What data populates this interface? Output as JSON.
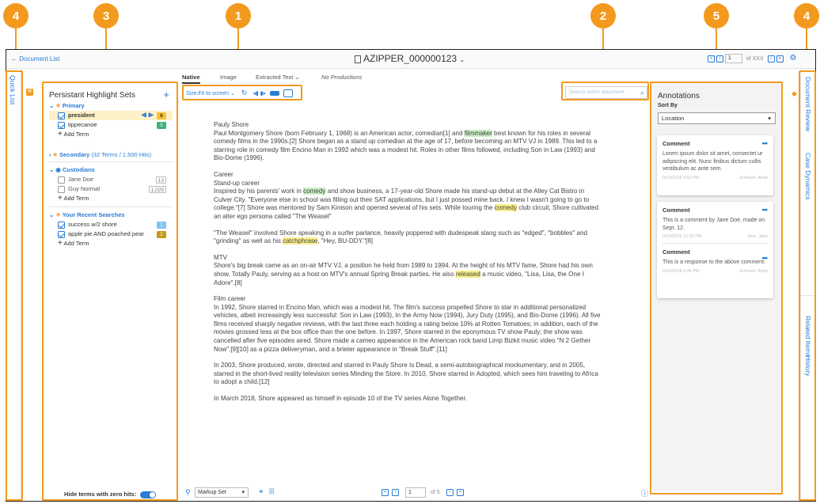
{
  "callouts": [
    "4",
    "3",
    "1",
    "2",
    "5",
    "4"
  ],
  "topbar": {
    "back_link": "Document List",
    "doc_title": "AZIPPER_000000123",
    "page_value": "1",
    "page_of": "of XXX"
  },
  "left_rail": {
    "quick_list": "Quick List"
  },
  "highlight_sets": {
    "title": "Persistant Highlight Sets",
    "primary": {
      "label": "Primary",
      "terms": [
        {
          "label": "president",
          "count": "6",
          "checked": true
        },
        {
          "label": "tippecanoe",
          "count": "5",
          "checked": true
        }
      ],
      "add_term": "Add Term"
    },
    "secondary": {
      "label": "Secondary",
      "meta": "(32 Terms / 1,500 Hits)"
    },
    "custodians": {
      "label": "Custodians",
      "terms": [
        {
          "label": "Jane Doe",
          "count": "13"
        },
        {
          "label": "Guy Normal",
          "count": "1,029"
        }
      ],
      "add_term": "Add Term"
    },
    "recent": {
      "label": "Your Recent Searches",
      "terms": [
        {
          "label": "success w/2 shore",
          "count": "1"
        },
        {
          "label": "apple pie AND poached pear",
          "count": "2"
        }
      ],
      "add_term": "Add Term"
    },
    "hide_terms": "Hide terms with zero hits:"
  },
  "viewer": {
    "tabs": [
      "Native",
      "Image",
      "Extracted Text",
      "No Productions"
    ],
    "size_label": "Size:Fit to screen",
    "search_placeholder": "Search within document",
    "markup_select": "Markup Set",
    "page_value": "1",
    "page_of": "of 5"
  },
  "doc": {
    "heading": "Pauly Shore",
    "p1": [
      "Paul Montgomery Shore (born February 1, 1968) is an American actor, comedian[1] and ",
      "filmmaker",
      " best known for his roles in several",
      "comedy films in the 1990s.[2] Shore began as a stand up comedian at the age of 17, before becoming an MTV VJ in 1989. This led to a",
      "starring role in comedy film Encino Man in 1992 which was a modest hit. Roles in other films followed, including Son in Law (1993) and",
      "Bio-Dome (1996)."
    ],
    "career": "Career",
    "standup": "Stand-up career",
    "p2": [
      "Inspired by his parents' work in ",
      "comedy",
      " and show business, a 17-year-old Shore made his stand-up debut at the Alley Cat Bistro in",
      "Culver City. \"Everyone else in school was filling out their SAT applications, but I just possed mine back. I knew I wasn't going to go to",
      "college.\"[7] Shore was mentored by Sam Kinison and opened several of his sets. While touring the ",
      "comedy",
      " club circuit, Shore cultivated",
      "an alter ego persona called \"The Weasel\""
    ],
    "p3": [
      "\"The Weasel\" involved Shore speaking in a surfer parlance, heavily poppered with dudespeak slang such as \"edged\", \"bobbles\" and",
      "\"grinding\" as well as his ",
      "catchphrase",
      ", \"Hey, BU-DDY.\"[8]"
    ],
    "mtv": "MTV",
    "p4": [
      "Shore's big break came as an on-air MTV VJ, a position he held from 1989 to 1994. At the height of his MTV fame, Shore had his own",
      "show, Totally Pauly, serving as a host on MTV's annual Spring Break parties. He also ",
      "released",
      " a music video, \"Lisa, Lisa, the One I",
      "Adore\".[8]"
    ],
    "film": "Film career",
    "p5": [
      "In 1992, Shore starred in Encino Man, which was a modest hit. The film's success propelled Shore to star in additional personalized",
      "vehicles, albeit increasingly less successful: Son in Law (1993), In the Army Now (1994), Jury Duty (1995), and Bio-Dome (1996). All five",
      "films received sharply negative reviews, with the last three each holding a rating below 10% at Rotten Tomatoes; in addition, each of the",
      "movies grossed less at the box office than the one before. In 1997, Shore starred in the eponymous TV show Pauly; the show was",
      "cancelled after five episodes aired. Shore made a cameo appearance in the American rock band Limp Bizkit music video \"N 2 Gether",
      "Now\".[9][10] as a pizza deliveryman, and a brieter appearance in \"Break Stuff\".[11]"
    ],
    "p6": [
      "In 2003, Shore produced, wrote, directed and starred in Pauly Shore Is Dead, a semi-autobiographical mockumentary, and in 2005,",
      "starred in the short-lived reality television series Minding the Store. In 2010, Shore starred in Adopted, which sees him traveling to Africa",
      "to adopt a child.[12]"
    ],
    "p7": "In March 2018, Shore appeared as himself in episode 10 of the TV series Alone Together."
  },
  "annotations": {
    "title": "Annotations",
    "sort_by": "Sort By",
    "sort_value": "Location",
    "cards": [
      {
        "title": "Comment",
        "body": "Lorem ipsum dolor sit amet, consectet ur adipiscing elit. Nunc finibus dictum cullis vestibulum ac ante sem.",
        "date": "9/10/2019 3:53 PM",
        "author": "Johnson, Andy"
      },
      {
        "title": "Comment",
        "body": "This is a comment by Jane Doe, made on Sept. 12.",
        "date": "9/12/2019 12:33 PM",
        "author": "Doe, Jane"
      },
      {
        "title": "Comment",
        "body": "This is a response to the above comment.",
        "date": "9/12/2019 2:36 PM",
        "author": "Johnson, Andy"
      }
    ]
  },
  "right_rail": {
    "items": [
      "Document Review",
      "Case Dynamics",
      "Related Items",
      "History"
    ]
  },
  "colors": {
    "accent": "#f39a1e",
    "link": "#2a7bd4",
    "green_highlight": "#c9efc4",
    "yellow_highlight": "#f8ef8a"
  }
}
